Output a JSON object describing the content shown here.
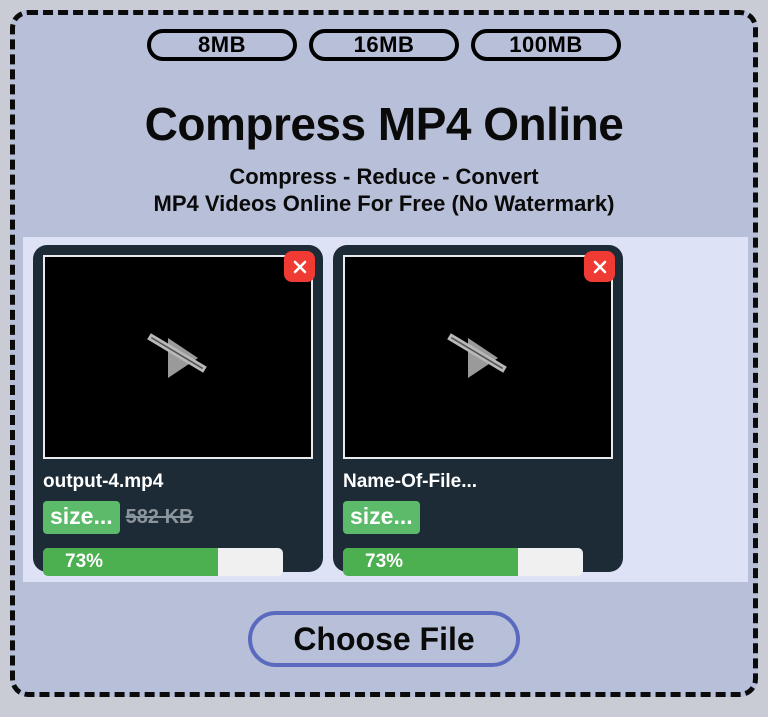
{
  "size_presets": [
    {
      "label": "8MB"
    },
    {
      "label": "16MB"
    },
    {
      "label": "100MB"
    }
  ],
  "header": {
    "title": "Compress MP4 Online",
    "subtitle_line1": "Compress - Reduce - Convert",
    "subtitle_line2": "MP4 Videos Online For Free (No Watermark)"
  },
  "files": [
    {
      "name": "output-4.mp4",
      "size_badge": "size...",
      "original_size": "582 KB",
      "progress_label": "73%",
      "progress_percent": 73,
      "close_icon": "close-icon",
      "thumb_icon": "video-unavailable-icon"
    },
    {
      "name": "Name-Of-File...",
      "size_badge": "size...",
      "original_size": "",
      "progress_label": "73%",
      "progress_percent": 73,
      "close_icon": "close-icon",
      "thumb_icon": "video-unavailable-icon"
    }
  ],
  "actions": {
    "choose_file": "Choose File"
  },
  "colors": {
    "page_bg": "#c9ccd4",
    "panel_bg": "#b8bfd8",
    "filelist_bg": "#dde2f7",
    "card_bg": "#1c2b36",
    "accent_green": "#4caf50",
    "badge_green": "#5cbb6a",
    "close_red": "#ef3b33",
    "choose_border": "#5a6bbf",
    "dash_border": "#0b0b0b"
  }
}
